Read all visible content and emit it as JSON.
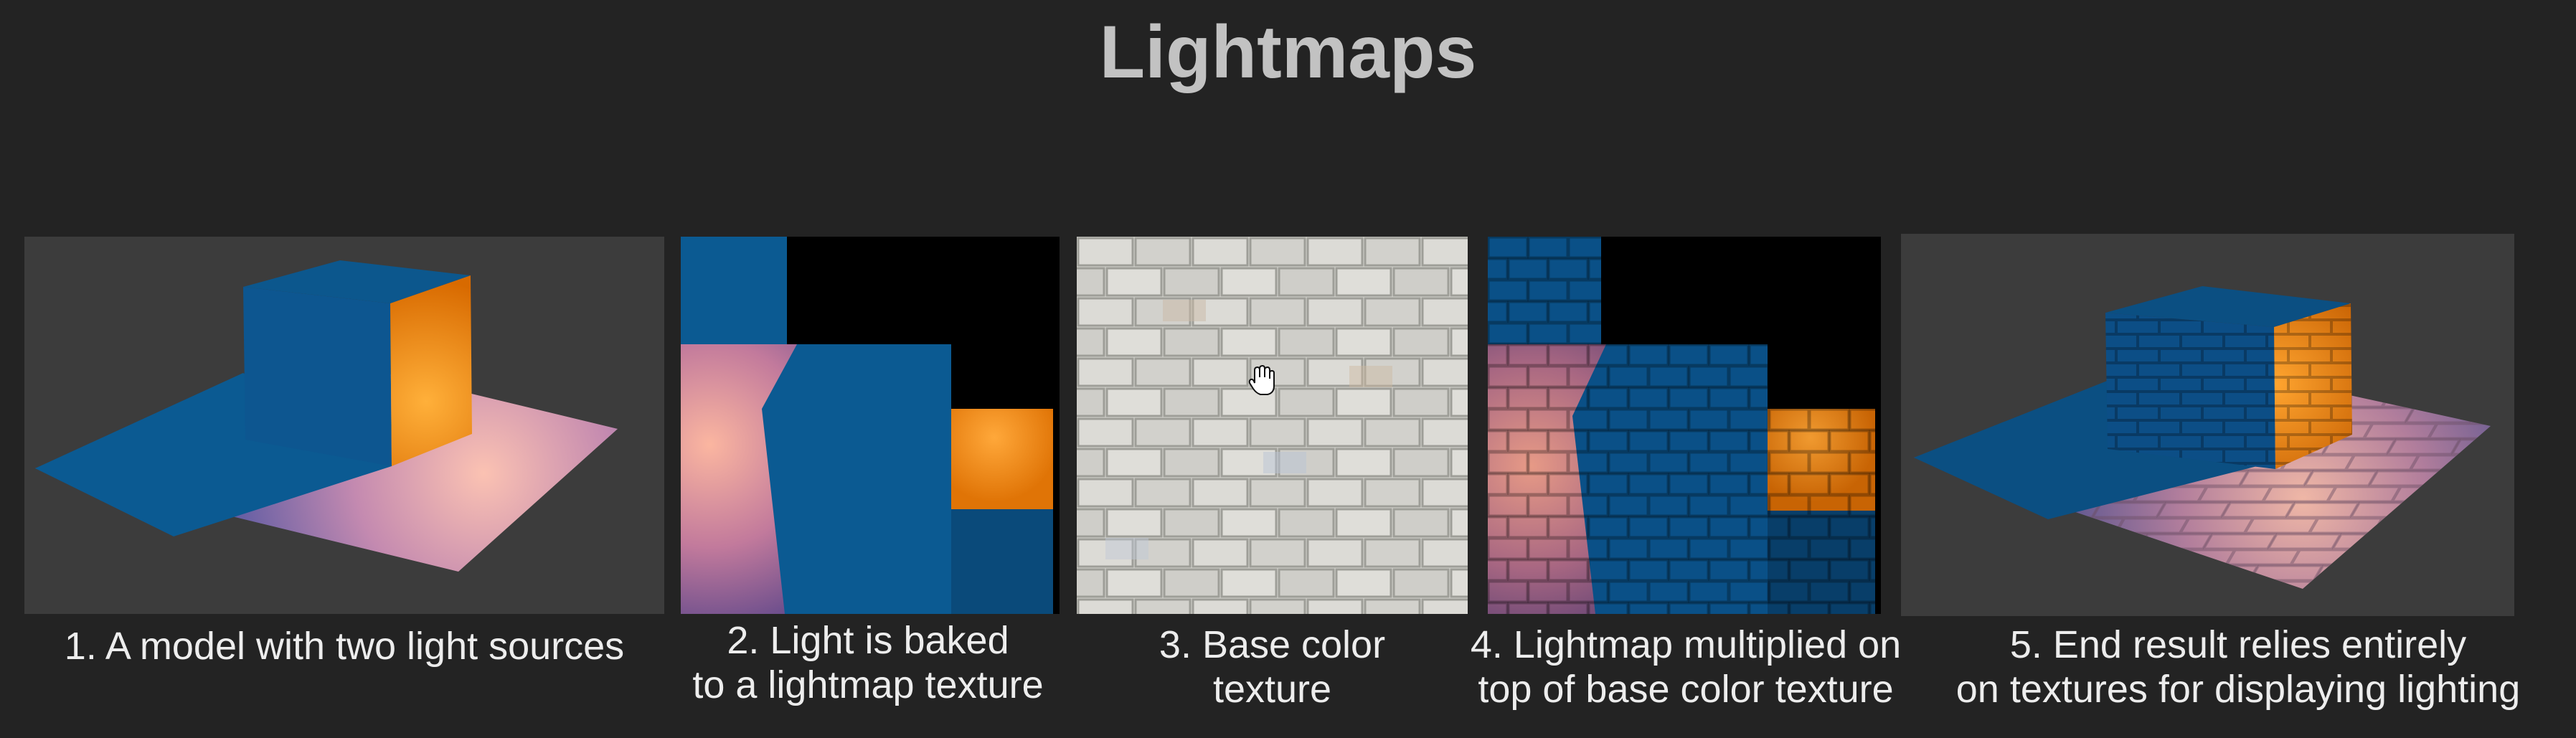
{
  "title": "Lightmaps",
  "panels": [
    {
      "caption_line1": "1. A model with two light sources",
      "caption_line2": ""
    },
    {
      "caption_line1": "2. Light is baked",
      "caption_line2": "to a lightmap texture"
    },
    {
      "caption_line1": "3. Base color",
      "caption_line2": "texture"
    },
    {
      "caption_line1": "4. Lightmap multiplied on",
      "caption_line2": "top of base color texture"
    },
    {
      "caption_line1": "5. End result relies entirely",
      "caption_line2": "on textures for displaying lighting"
    }
  ],
  "colors": {
    "background": "#232323",
    "title": "#c2c2c2",
    "caption": "#ededed",
    "blue": "#0b5a92",
    "orange": "#f08a0e",
    "pink_light": "#f0b6a8"
  }
}
